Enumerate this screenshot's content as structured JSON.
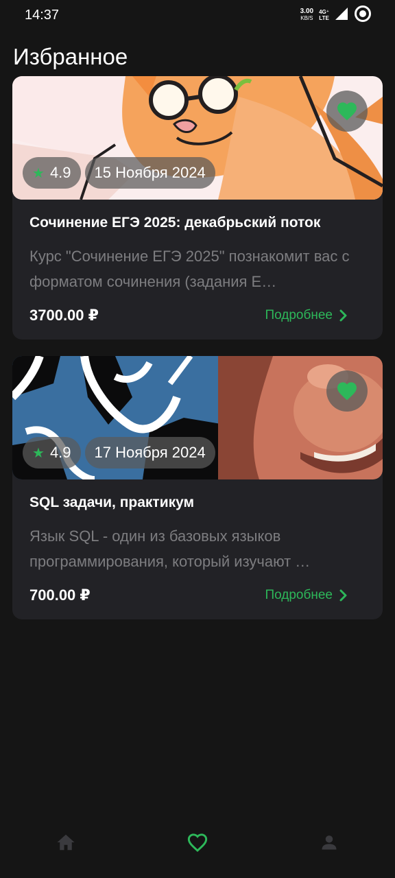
{
  "status_bar": {
    "time": "14:37",
    "net_speed": "3.00",
    "net_unit": "KB/S",
    "net_type_top": "4G⁺",
    "net_type_bottom": "LTE"
  },
  "page": {
    "title": "Избранное"
  },
  "courses": [
    {
      "rating": "4.9",
      "date": "15 Ноября 2024",
      "title": "Сочинение ЕГЭ 2025: декабрьский поток",
      "description": "Курс \"Сочинение ЕГЭ 2025\" познакомит вас с форматом сочинения (задания Е…",
      "price": "3700.00 ₽",
      "details_label": "Подробнее",
      "favorited": true
    },
    {
      "rating": "4.9",
      "date": "17 Ноября 2024",
      "title": "SQL задачи, практикум",
      "description": "Язык SQL - один из базовых языков программирования, который изучают …",
      "price": "700.00 ₽",
      "details_label": "Подробнее",
      "favorited": true
    }
  ],
  "bottom_nav": {
    "items": [
      {
        "icon": "home-icon",
        "active": false
      },
      {
        "icon": "heart-outline-icon",
        "active": true
      },
      {
        "icon": "person-icon",
        "active": false
      }
    ]
  },
  "colors": {
    "background": "#151515",
    "card": "#222226",
    "accent": "#2db85a",
    "muted_text": "#7d7d80",
    "inactive_icon": "#3a3a3e"
  }
}
